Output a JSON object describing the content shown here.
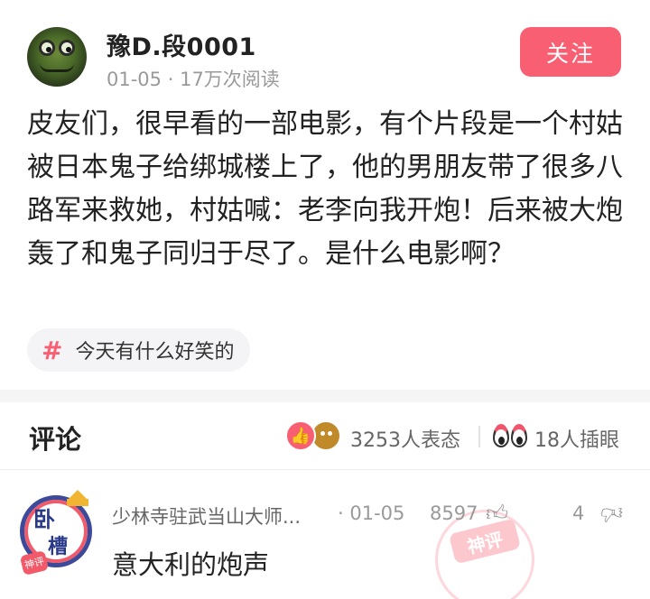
{
  "post": {
    "author": "豫D.段0001",
    "date": "01-05",
    "views": "17万次阅读",
    "follow_label": "关注",
    "content": "皮友们，很早看的一部电影，有个片段是一个村姑被日本鬼子给绑城楼上了，他的男朋友带了很多八路军来救她，村姑喊：老李向我开炮！后来被大炮轰了和鬼子同归于尽了。是什么电影啊？",
    "tag": {
      "symbol": "#",
      "label": "今天有什么好笑的"
    }
  },
  "comments_section": {
    "title": "评论",
    "reactions_count": "3253人表态",
    "eyes_count": "18人插眼"
  },
  "comments": [
    {
      "author": "少林寺驻武当山大师...",
      "date": "01-05",
      "likes": "8597",
      "dislikes": "4",
      "text": "意大利的炮声",
      "badge": "神评",
      "avatar_text_1": "卧",
      "avatar_text_2": "槽",
      "avatar_badge": "神评"
    }
  ],
  "icons": {
    "like": "thumbs-up-icon",
    "dislike": "thumbs-down-icon",
    "hashtag": "hashtag-icon",
    "reaction_like": "heart-reaction-icon",
    "reaction_poop": "poop-reaction-icon",
    "eyes": "eyes-icon"
  },
  "colors": {
    "accent": "#f95f72",
    "text": "#222222",
    "muted": "#9a9a9a"
  }
}
